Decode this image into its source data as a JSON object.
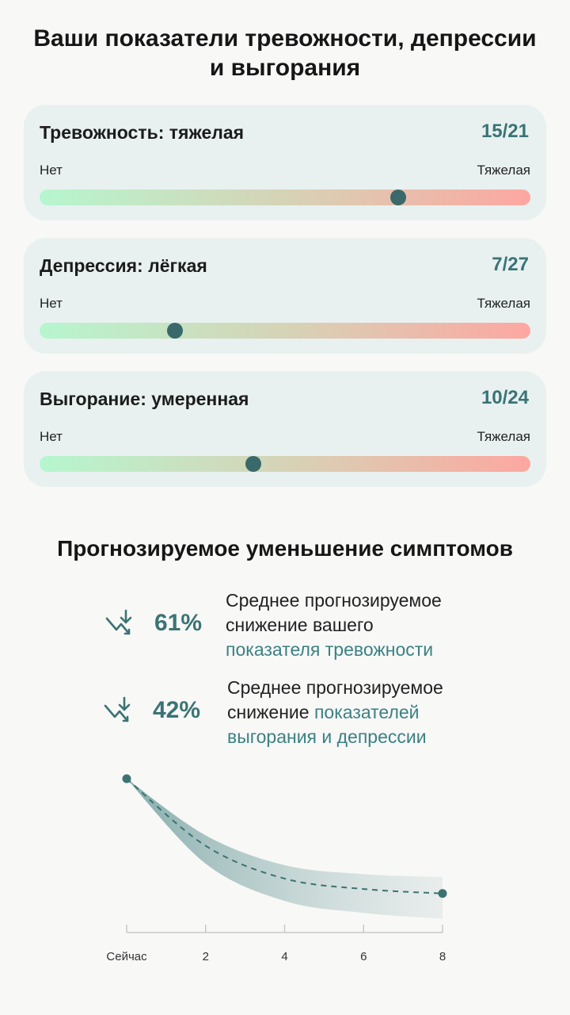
{
  "header": {
    "title_line1": "Ваши показатели тревожности, депрессии",
    "title_line2": "и выгорания"
  },
  "scores": [
    {
      "label": "Тревожность: тяжелая",
      "score": "15/21",
      "scale_min": "Нет",
      "scale_max": "Тяжелая",
      "level": 0.73
    },
    {
      "label": "Депрессия: лёгкая",
      "score": "7/27",
      "scale_min": "Нет",
      "scale_max": "Тяжелая",
      "level": 0.275
    },
    {
      "label": "Выгорание: умеренная",
      "score": "10/24",
      "scale_min": "Нет",
      "scale_max": "Тяжелая",
      "level": 0.435
    }
  ],
  "forecast": {
    "title": "Прогнозируемое уменьшение симптомов",
    "stats": [
      {
        "percent": "61%",
        "text_line1": "Среднее прогнозируемое",
        "text_line2": "снижение вашего",
        "text_highlight": "показателя тревожности"
      },
      {
        "percent": "42%",
        "text_line1": "Среднее прогнозируемое",
        "text_plain": "снижение ",
        "text_highlight1": "показателей",
        "text_highlight2": "выгорания и депрессии"
      }
    ]
  },
  "chart_data": {
    "type": "line",
    "x_tick_labels": [
      "Сейчас",
      "2",
      "4",
      "6",
      "8"
    ],
    "x": [
      0,
      2,
      4,
      6,
      8
    ],
    "note_values": "relative projected score, 1.0 = now",
    "values": [
      1.0,
      0.55,
      0.33,
      0.26,
      0.23
    ],
    "band_upper": [
      1.0,
      0.62,
      0.42,
      0.36,
      0.34
    ],
    "band_lower": [
      1.0,
      0.43,
      0.18,
      0.1,
      0.06
    ],
    "colors": {
      "line": "#3d7273",
      "band": "#8fb5b4",
      "dot": "#3d7273"
    }
  }
}
